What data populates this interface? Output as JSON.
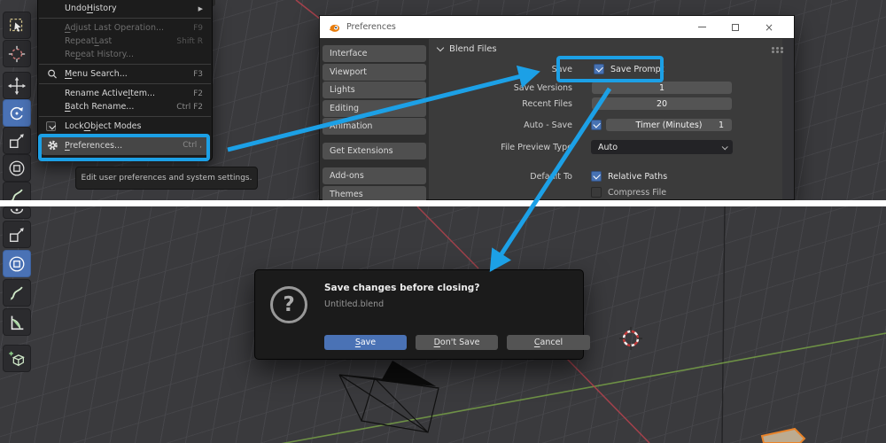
{
  "icons": {
    "submenu_arrow": "▶",
    "question": "?",
    "close": "×"
  },
  "colors": {
    "annotation_blue": "#1ca0e6",
    "accent_blue": "#4772b3",
    "axis_red": "#b8434e",
    "axis_green": "#739a46",
    "selection_orange": "#e8832a",
    "viewport_bg": "#3a3a3d"
  },
  "toolbar_top": {
    "items": [
      {
        "name": "box-select-tool",
        "selected": false
      },
      {
        "name": "cursor-tool",
        "selected": false
      },
      {
        "name": "move-tool",
        "selected": false
      },
      {
        "name": "rotate-tool",
        "selected": true
      },
      {
        "name": "scale-tool",
        "selected": false
      },
      {
        "name": "transform-tool",
        "selected": false
      },
      {
        "name": "annotate-tool",
        "selected": false
      }
    ]
  },
  "toolbar_bottom": {
    "items": [
      {
        "name": "rotate-tool-partial",
        "selected": false
      },
      {
        "name": "scale-tool",
        "selected": false
      },
      {
        "name": "transform-tool",
        "selected": true
      },
      {
        "name": "annotate-tool",
        "selected": false
      },
      {
        "name": "measure-tool",
        "selected": false
      },
      {
        "name": "add-cube-tool",
        "selected": false
      }
    ]
  },
  "edit_menu": {
    "items": [
      {
        "pre": "Undo ",
        "accel": "H",
        "post": "istory",
        "shortcut": "",
        "submenu": true
      },
      {
        "pre": "",
        "accel": "A",
        "post": "djust Last Operation...",
        "shortcut": "F9",
        "disabled": true
      },
      {
        "pre": "Repeat ",
        "accel": "L",
        "post": "ast",
        "shortcut": "Shift R",
        "disabled": true
      },
      {
        "pre": "Re",
        "accel": "p",
        "post": "eat History...",
        "shortcut": "",
        "disabled": true
      },
      {
        "pre": "",
        "accel": "M",
        "post": "enu Search...",
        "shortcut": "F3"
      },
      {
        "pre": "Rename Active ",
        "accel": "I",
        "post": "tem...",
        "shortcut": "F2"
      },
      {
        "pre": "",
        "accel": "B",
        "post": "atch Rename...",
        "shortcut": "Ctrl F2"
      },
      {
        "pre": "Lock ",
        "accel": "O",
        "post": "bject Modes",
        "shortcut": "",
        "checked": true
      },
      {
        "pre": "",
        "accel": "P",
        "post": "references...",
        "shortcut": "Ctrl ,",
        "highlighted": true
      }
    ]
  },
  "tooltip": {
    "text": "Edit user preferences and system settings."
  },
  "preferences_window": {
    "title": "Preferences",
    "sidebar": {
      "items": [
        "Interface",
        "Viewport",
        "Lights",
        "Editing",
        "Animation",
        "Get Extensions",
        "Add-ons",
        "Themes"
      ]
    },
    "panel": {
      "header": "Blend Files",
      "save_label": "Save",
      "save_prompt": {
        "label": "Save Prompt",
        "checked": true
      },
      "save_versions": {
        "label": "Save Versions",
        "value": "1"
      },
      "recent_files": {
        "label": "Recent Files",
        "value": "20"
      },
      "auto_save": {
        "label": "Auto - Save",
        "checked": true,
        "timer_label": "Timer (Minutes)",
        "timer_value": "1"
      },
      "file_preview_type": {
        "label": "File Preview Type",
        "value": "Auto"
      },
      "default_to": {
        "label": "Default To"
      },
      "relative_paths": {
        "label": "Relative Paths",
        "checked": true
      },
      "compress_file": {
        "label": "Compress File",
        "checked": false
      }
    }
  },
  "save_dialog": {
    "title": "Save changes before closing?",
    "filename": "Untitled.blend",
    "buttons": [
      {
        "accel": "S",
        "rest": "ave",
        "primary": true
      },
      {
        "accel": "D",
        "rest": "on't Save",
        "primary": false
      },
      {
        "accel": "C",
        "rest": "ancel",
        "primary": false
      }
    ]
  }
}
